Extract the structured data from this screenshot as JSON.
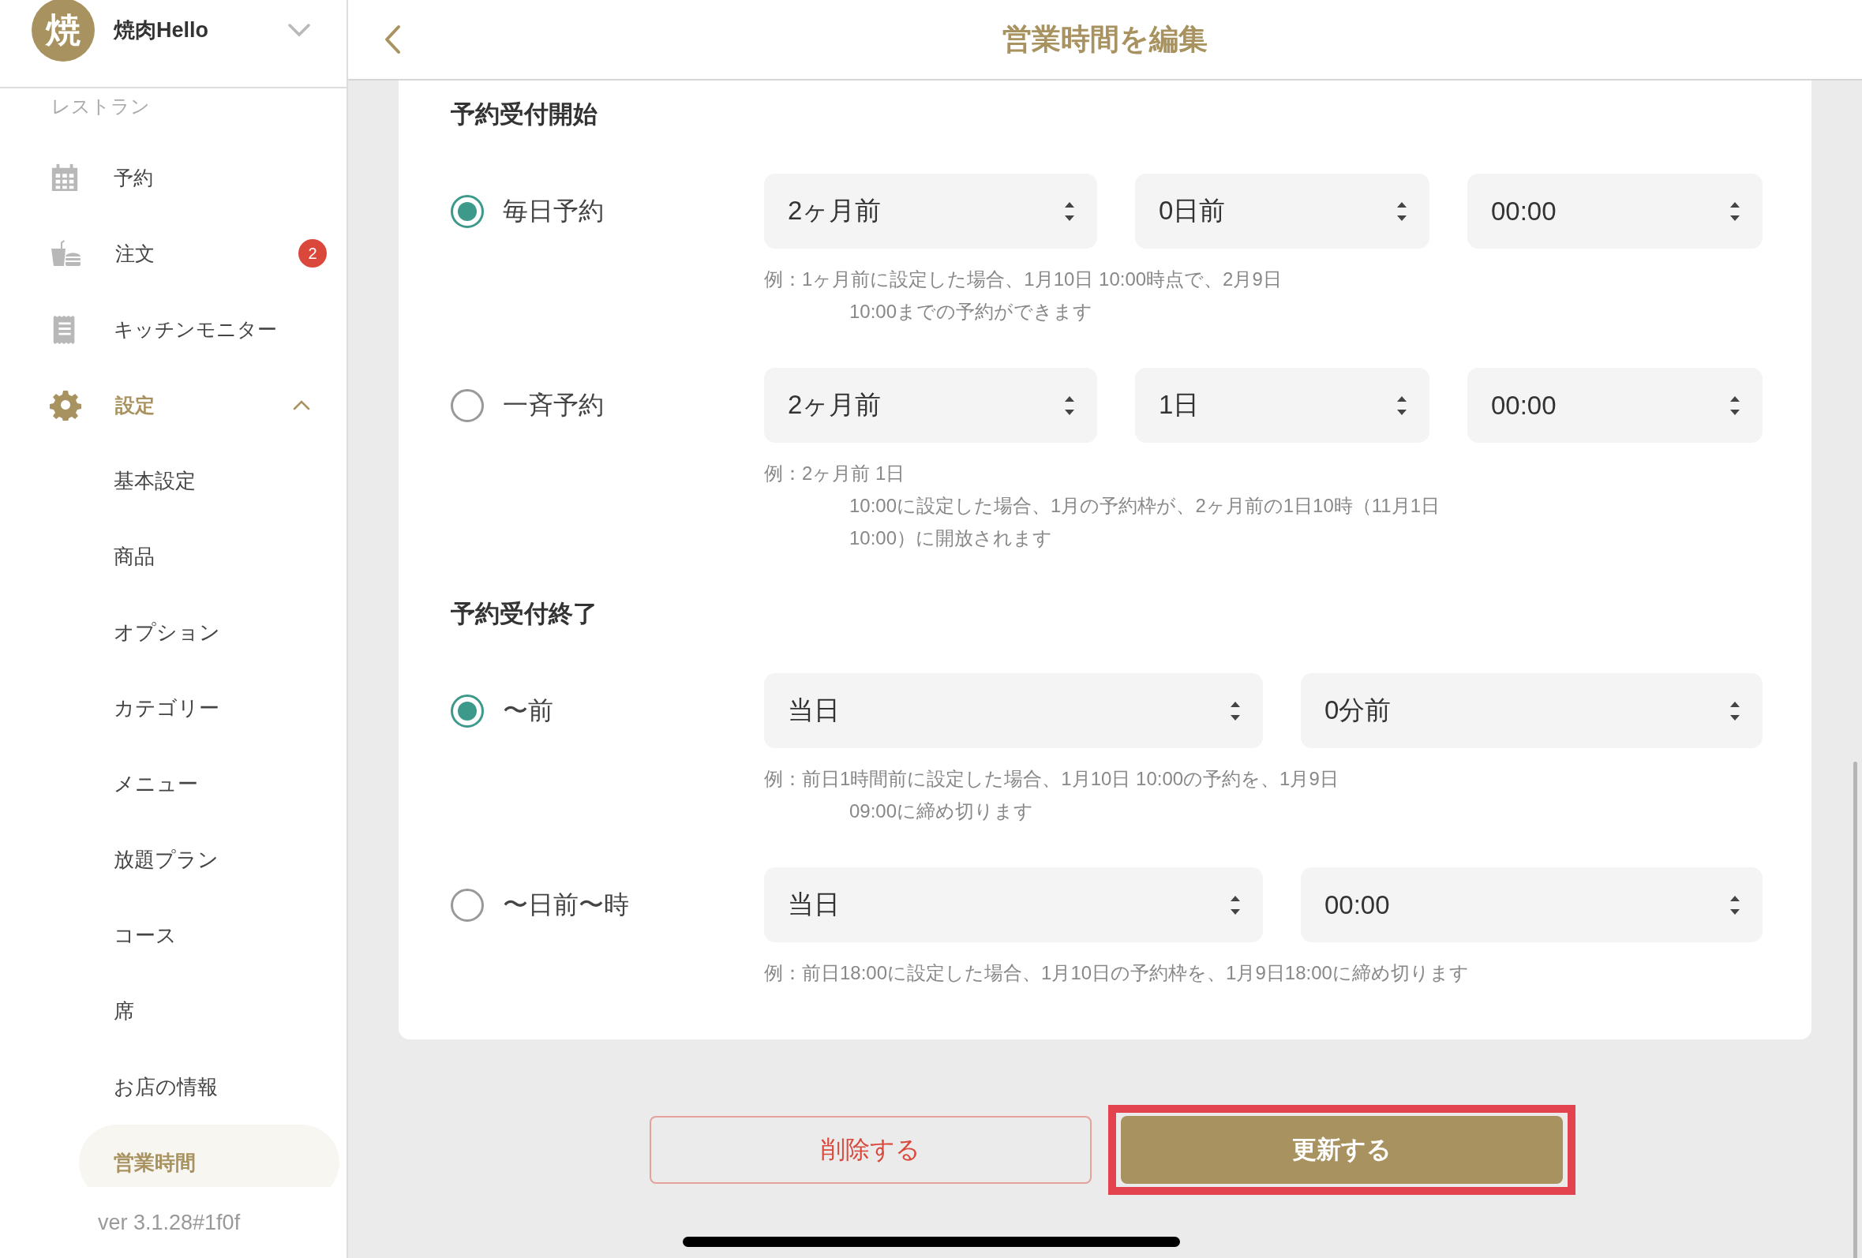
{
  "sidebar": {
    "shop": {
      "avatar": "焼",
      "name": "焼肉Hello"
    },
    "section_label": "レストラン",
    "items": [
      {
        "label": "予約",
        "kind": "calendar",
        "selected": false
      },
      {
        "label": "注文",
        "kind": "order",
        "selected": false,
        "badge": "2"
      },
      {
        "label": "キッチンモニター",
        "kind": "receipt",
        "selected": false
      },
      {
        "label": "設定",
        "kind": "gear",
        "selected": true,
        "expanded": true,
        "children": [
          {
            "label": "基本設定",
            "selected": false
          },
          {
            "label": "商品",
            "selected": false
          },
          {
            "label": "オプション",
            "selected": false
          },
          {
            "label": "カテゴリー",
            "selected": false
          },
          {
            "label": "メニュー",
            "selected": false
          },
          {
            "label": "放題プラン",
            "selected": false
          },
          {
            "label": "コース",
            "selected": false
          },
          {
            "label": "席",
            "selected": false
          },
          {
            "label": "お店の情報",
            "selected": false
          },
          {
            "label": "営業時間",
            "selected": true
          }
        ]
      }
    ],
    "version": "ver 3.1.28#1f0f"
  },
  "header": {
    "title": "営業時間を編集"
  },
  "sections": [
    {
      "title": "予約受付開始",
      "options": [
        {
          "label": "毎日予約",
          "selected": true,
          "selects": [
            "2ヶ月前",
            "0日前",
            "00:00"
          ],
          "hint": [
            "例：1ヶ月前に設定した場合、1月10日 10:00時点で、2月9日",
            "10:00までの予約ができます"
          ]
        },
        {
          "label": "一斉予約",
          "selected": false,
          "selects": [
            "2ヶ月前",
            "1日",
            "00:00"
          ],
          "hint": [
            "例：2ヶ月前 1日",
            "10:00に設定した場合、1月の予約枠が、2ヶ月前の1日10時（11月1日",
            "10:00）に開放されます"
          ]
        }
      ]
    },
    {
      "title": "予約受付終了",
      "options": [
        {
          "label": "〜前",
          "selected": true,
          "selects": [
            "当日",
            "0分前"
          ],
          "hint": [
            "例：前日1時間前に設定した場合、1月10日 10:00の予約を、1月9日",
            "09:00に締め切ります"
          ]
        },
        {
          "label": "〜日前〜時",
          "selected": false,
          "selects": [
            "当日",
            "00:00"
          ],
          "hint": [
            "例：前日18:00に設定した場合、1月10日の予約枠を、1月9日18:00に締め切ります"
          ]
        }
      ]
    }
  ],
  "buttons": [
    {
      "label": "削除する",
      "kind": "danger",
      "highlighted": false
    },
    {
      "label": "更新する",
      "kind": "primary",
      "highlighted": true
    }
  ]
}
